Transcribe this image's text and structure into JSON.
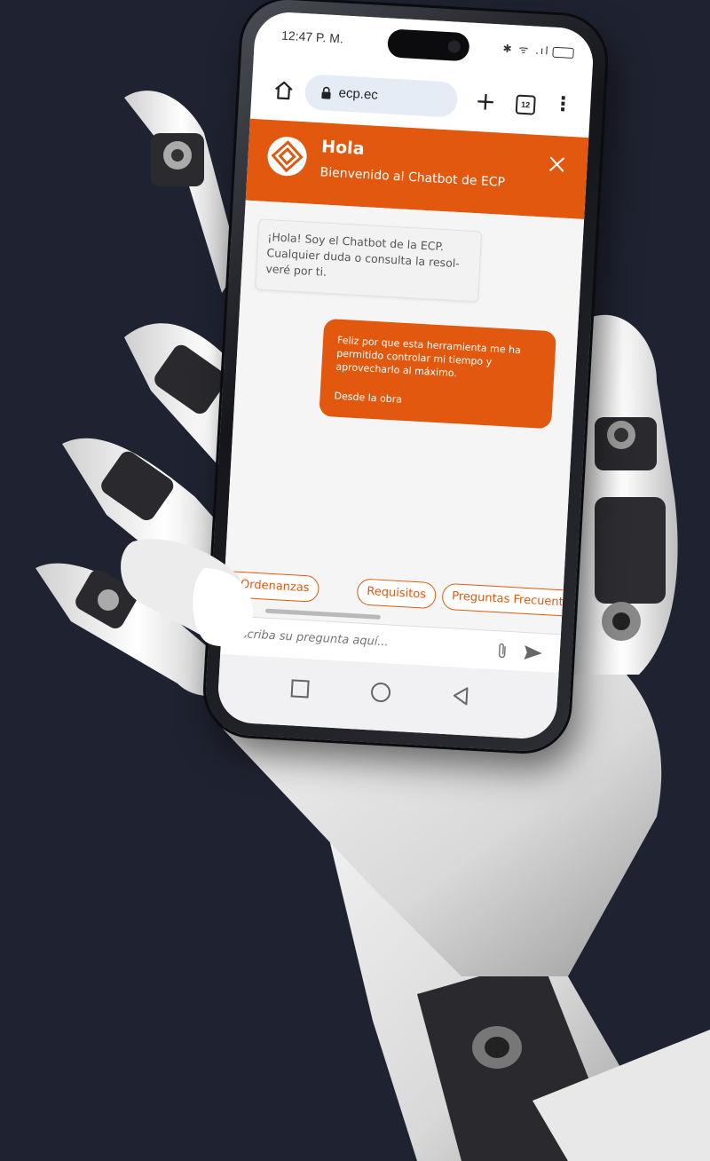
{
  "status_bar": {
    "time": "12:47 P. M.",
    "icons": "✱ ᯤ .ıl"
  },
  "browser": {
    "url": "ecp.ec",
    "new_tab_label": "+",
    "tab_count": "12",
    "menu_label": "⋮"
  },
  "chat_header": {
    "title": "Hola",
    "subtitle": "Bienvenido al Chatbot de ECP"
  },
  "messages": {
    "bot": "¡Hola! Soy el Chatbot de la ECP. Cualquier duda o consulta la resol-veré por ti.",
    "user": "Feliz por que esta herramienta me ha permitido controlar mi tiempo y aprovecharlo al máximo.",
    "user_signature": "Desde la obra"
  },
  "quick_replies": [
    {
      "label": "Leyes y Ordenanzas"
    },
    {
      "label": "Requisitos"
    },
    {
      "label": "Preguntas Frecuentes"
    }
  ],
  "composer": {
    "placeholder": "Escriba su pregunta aquí..."
  },
  "colors": {
    "brand_orange": "#e2580f",
    "background": "#1f2230"
  }
}
